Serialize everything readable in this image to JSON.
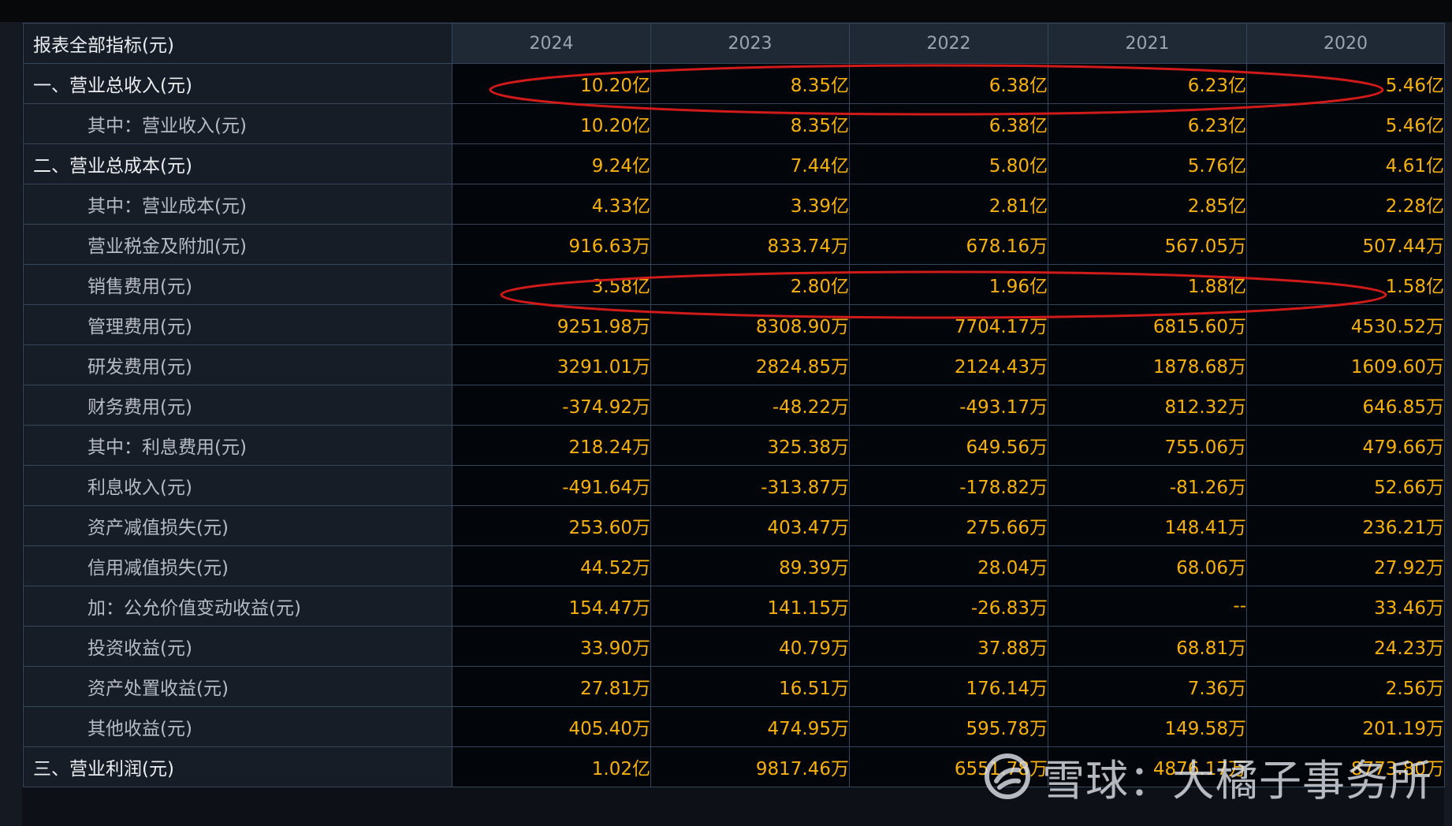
{
  "table": {
    "header_label": "报表全部指标(元)",
    "years": [
      "2024",
      "2023",
      "2022",
      "2021",
      "2020"
    ],
    "rows": [
      {
        "label": "一、营业总收入(元)",
        "level": 0,
        "values": [
          "10.20亿",
          "8.35亿",
          "6.38亿",
          "6.23亿",
          "5.46亿"
        ]
      },
      {
        "label": "其中：营业收入(元)",
        "level": 1,
        "values": [
          "10.20亿",
          "8.35亿",
          "6.38亿",
          "6.23亿",
          "5.46亿"
        ]
      },
      {
        "label": "二、营业总成本(元)",
        "level": 0,
        "values": [
          "9.24亿",
          "7.44亿",
          "5.80亿",
          "5.76亿",
          "4.61亿"
        ]
      },
      {
        "label": "其中：营业成本(元)",
        "level": 1,
        "values": [
          "4.33亿",
          "3.39亿",
          "2.81亿",
          "2.85亿",
          "2.28亿"
        ]
      },
      {
        "label": "营业税金及附加(元)",
        "level": 1,
        "values": [
          "916.63万",
          "833.74万",
          "678.16万",
          "567.05万",
          "507.44万"
        ]
      },
      {
        "label": "销售费用(元)",
        "level": 1,
        "values": [
          "3.58亿",
          "2.80亿",
          "1.96亿",
          "1.88亿",
          "1.58亿"
        ]
      },
      {
        "label": "管理费用(元)",
        "level": 1,
        "values": [
          "9251.98万",
          "8308.90万",
          "7704.17万",
          "6815.60万",
          "4530.52万"
        ]
      },
      {
        "label": "研发费用(元)",
        "level": 1,
        "values": [
          "3291.01万",
          "2824.85万",
          "2124.43万",
          "1878.68万",
          "1609.60万"
        ]
      },
      {
        "label": "财务费用(元)",
        "level": 1,
        "values": [
          "-374.92万",
          "-48.22万",
          "-493.17万",
          "812.32万",
          "646.85万"
        ]
      },
      {
        "label": "其中：利息费用(元)",
        "level": 1,
        "values": [
          "218.24万",
          "325.38万",
          "649.56万",
          "755.06万",
          "479.66万"
        ]
      },
      {
        "label": "利息收入(元)",
        "level": 1,
        "values": [
          "-491.64万",
          "-313.87万",
          "-178.82万",
          "-81.26万",
          "52.66万"
        ]
      },
      {
        "label": "资产减值损失(元)",
        "level": 1,
        "values": [
          "253.60万",
          "403.47万",
          "275.66万",
          "148.41万",
          "236.21万"
        ]
      },
      {
        "label": "信用减值损失(元)",
        "level": 1,
        "values": [
          "44.52万",
          "89.39万",
          "28.04万",
          "68.06万",
          "27.92万"
        ]
      },
      {
        "label": "加：公允价值变动收益(元)",
        "level": 1,
        "values": [
          "154.47万",
          "141.15万",
          "-26.83万",
          "--",
          "33.46万"
        ]
      },
      {
        "label": "投资收益(元)",
        "level": 1,
        "values": [
          "33.90万",
          "40.79万",
          "37.88万",
          "68.81万",
          "24.23万"
        ]
      },
      {
        "label": "资产处置收益(元)",
        "level": 1,
        "values": [
          "27.81万",
          "16.51万",
          "176.14万",
          "7.36万",
          "2.56万"
        ]
      },
      {
        "label": "其他收益(元)",
        "level": 1,
        "values": [
          "405.40万",
          "474.95万",
          "595.78万",
          "149.58万",
          "201.19万"
        ]
      },
      {
        "label": "三、营业利润(元)",
        "level": 0,
        "values": [
          "1.02亿",
          "9817.46万",
          "6551.78万",
          "4876.17万",
          "8773.80万"
        ]
      }
    ]
  },
  "annotations": {
    "ellipse_color": "#d11a1a",
    "highlighted_rows": [
      "一、营业总收入(元)",
      "销售费用(元)"
    ]
  },
  "watermark": {
    "text": "雪球：大橘子事务所",
    "icon": "snowball-logo-icon"
  }
}
